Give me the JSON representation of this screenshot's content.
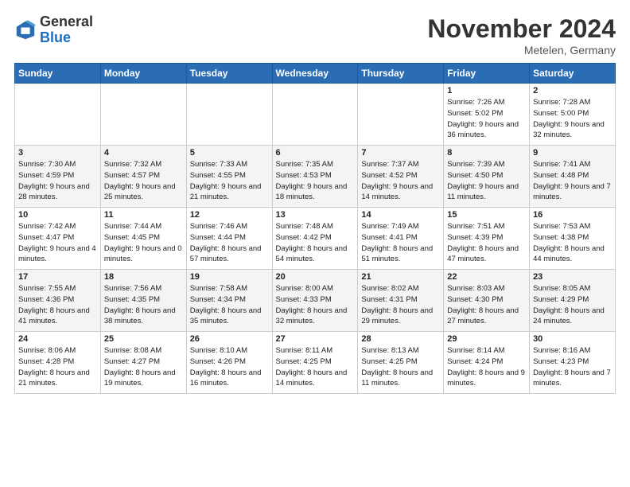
{
  "header": {
    "logo_general": "General",
    "logo_blue": "Blue",
    "month": "November 2024",
    "location": "Metelen, Germany"
  },
  "weekdays": [
    "Sunday",
    "Monday",
    "Tuesday",
    "Wednesday",
    "Thursday",
    "Friday",
    "Saturday"
  ],
  "weeks": [
    [
      {
        "day": "",
        "info": ""
      },
      {
        "day": "",
        "info": ""
      },
      {
        "day": "",
        "info": ""
      },
      {
        "day": "",
        "info": ""
      },
      {
        "day": "",
        "info": ""
      },
      {
        "day": "1",
        "info": "Sunrise: 7:26 AM\nSunset: 5:02 PM\nDaylight: 9 hours and 36 minutes."
      },
      {
        "day": "2",
        "info": "Sunrise: 7:28 AM\nSunset: 5:00 PM\nDaylight: 9 hours and 32 minutes."
      }
    ],
    [
      {
        "day": "3",
        "info": "Sunrise: 7:30 AM\nSunset: 4:59 PM\nDaylight: 9 hours and 28 minutes."
      },
      {
        "day": "4",
        "info": "Sunrise: 7:32 AM\nSunset: 4:57 PM\nDaylight: 9 hours and 25 minutes."
      },
      {
        "day": "5",
        "info": "Sunrise: 7:33 AM\nSunset: 4:55 PM\nDaylight: 9 hours and 21 minutes."
      },
      {
        "day": "6",
        "info": "Sunrise: 7:35 AM\nSunset: 4:53 PM\nDaylight: 9 hours and 18 minutes."
      },
      {
        "day": "7",
        "info": "Sunrise: 7:37 AM\nSunset: 4:52 PM\nDaylight: 9 hours and 14 minutes."
      },
      {
        "day": "8",
        "info": "Sunrise: 7:39 AM\nSunset: 4:50 PM\nDaylight: 9 hours and 11 minutes."
      },
      {
        "day": "9",
        "info": "Sunrise: 7:41 AM\nSunset: 4:48 PM\nDaylight: 9 hours and 7 minutes."
      }
    ],
    [
      {
        "day": "10",
        "info": "Sunrise: 7:42 AM\nSunset: 4:47 PM\nDaylight: 9 hours and 4 minutes."
      },
      {
        "day": "11",
        "info": "Sunrise: 7:44 AM\nSunset: 4:45 PM\nDaylight: 9 hours and 0 minutes."
      },
      {
        "day": "12",
        "info": "Sunrise: 7:46 AM\nSunset: 4:44 PM\nDaylight: 8 hours and 57 minutes."
      },
      {
        "day": "13",
        "info": "Sunrise: 7:48 AM\nSunset: 4:42 PM\nDaylight: 8 hours and 54 minutes."
      },
      {
        "day": "14",
        "info": "Sunrise: 7:49 AM\nSunset: 4:41 PM\nDaylight: 8 hours and 51 minutes."
      },
      {
        "day": "15",
        "info": "Sunrise: 7:51 AM\nSunset: 4:39 PM\nDaylight: 8 hours and 47 minutes."
      },
      {
        "day": "16",
        "info": "Sunrise: 7:53 AM\nSunset: 4:38 PM\nDaylight: 8 hours and 44 minutes."
      }
    ],
    [
      {
        "day": "17",
        "info": "Sunrise: 7:55 AM\nSunset: 4:36 PM\nDaylight: 8 hours and 41 minutes."
      },
      {
        "day": "18",
        "info": "Sunrise: 7:56 AM\nSunset: 4:35 PM\nDaylight: 8 hours and 38 minutes."
      },
      {
        "day": "19",
        "info": "Sunrise: 7:58 AM\nSunset: 4:34 PM\nDaylight: 8 hours and 35 minutes."
      },
      {
        "day": "20",
        "info": "Sunrise: 8:00 AM\nSunset: 4:33 PM\nDaylight: 8 hours and 32 minutes."
      },
      {
        "day": "21",
        "info": "Sunrise: 8:02 AM\nSunset: 4:31 PM\nDaylight: 8 hours and 29 minutes."
      },
      {
        "day": "22",
        "info": "Sunrise: 8:03 AM\nSunset: 4:30 PM\nDaylight: 8 hours and 27 minutes."
      },
      {
        "day": "23",
        "info": "Sunrise: 8:05 AM\nSunset: 4:29 PM\nDaylight: 8 hours and 24 minutes."
      }
    ],
    [
      {
        "day": "24",
        "info": "Sunrise: 8:06 AM\nSunset: 4:28 PM\nDaylight: 8 hours and 21 minutes."
      },
      {
        "day": "25",
        "info": "Sunrise: 8:08 AM\nSunset: 4:27 PM\nDaylight: 8 hours and 19 minutes."
      },
      {
        "day": "26",
        "info": "Sunrise: 8:10 AM\nSunset: 4:26 PM\nDaylight: 8 hours and 16 minutes."
      },
      {
        "day": "27",
        "info": "Sunrise: 8:11 AM\nSunset: 4:25 PM\nDaylight: 8 hours and 14 minutes."
      },
      {
        "day": "28",
        "info": "Sunrise: 8:13 AM\nSunset: 4:25 PM\nDaylight: 8 hours and 11 minutes."
      },
      {
        "day": "29",
        "info": "Sunrise: 8:14 AM\nSunset: 4:24 PM\nDaylight: 8 hours and 9 minutes."
      },
      {
        "day": "30",
        "info": "Sunrise: 8:16 AM\nSunset: 4:23 PM\nDaylight: 8 hours and 7 minutes."
      }
    ]
  ]
}
